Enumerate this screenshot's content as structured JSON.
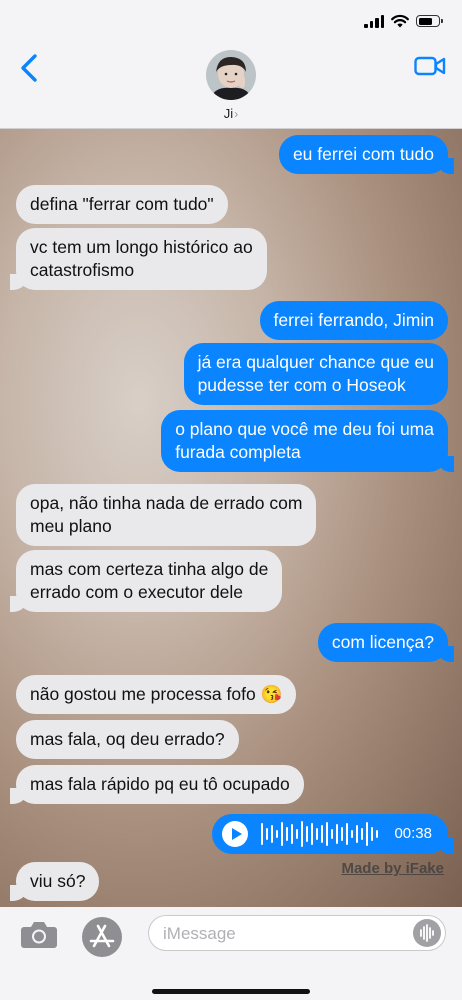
{
  "status_bar": {
    "time": ""
  },
  "header": {
    "contact_name": "Ji",
    "chevron": "›",
    "back_icon": "chevron-left-icon",
    "video_icon": "video-camera-icon"
  },
  "messages": [
    {
      "from": "me",
      "text": "eu ferrei com tudo"
    },
    {
      "from": "them",
      "text": "defina \"ferrar com tudo\""
    },
    {
      "from": "them",
      "text": "vc tem um longo histórico ao\ncatastrofismo"
    },
    {
      "from": "me",
      "text": "ferrei ferrando, Jimin"
    },
    {
      "from": "me",
      "text": "já era qualquer chance que eu\npudesse ter com o Hoseok"
    },
    {
      "from": "me",
      "text": "o plano que você me deu foi uma\nfurada completa"
    },
    {
      "from": "them",
      "text": "opa, não tinha nada de errado com\nmeu plano"
    },
    {
      "from": "them",
      "text": "mas com certeza tinha algo de\nerrado com o executor dele"
    },
    {
      "from": "me",
      "text": "com licença?"
    },
    {
      "from": "them",
      "text": "não gostou me processa fofo 😘"
    },
    {
      "from": "them",
      "text": "mas fala, oq deu errado?"
    },
    {
      "from": "them",
      "text": "mas fala rápido pq eu tô ocupado"
    },
    {
      "from": "them",
      "text": "viu só?"
    }
  ],
  "voice_message": {
    "duration": "00:38",
    "icon": "play-icon"
  },
  "watermark": "Made by iFake",
  "composer": {
    "placeholder": "iMessage",
    "camera_icon": "camera-icon",
    "apps_icon": "app-store-icon",
    "audio_icon": "waveform-icon"
  },
  "colors": {
    "outgoing": "#0a84ff",
    "incoming": "#e9e9eb",
    "accent": "#0a84ff"
  }
}
